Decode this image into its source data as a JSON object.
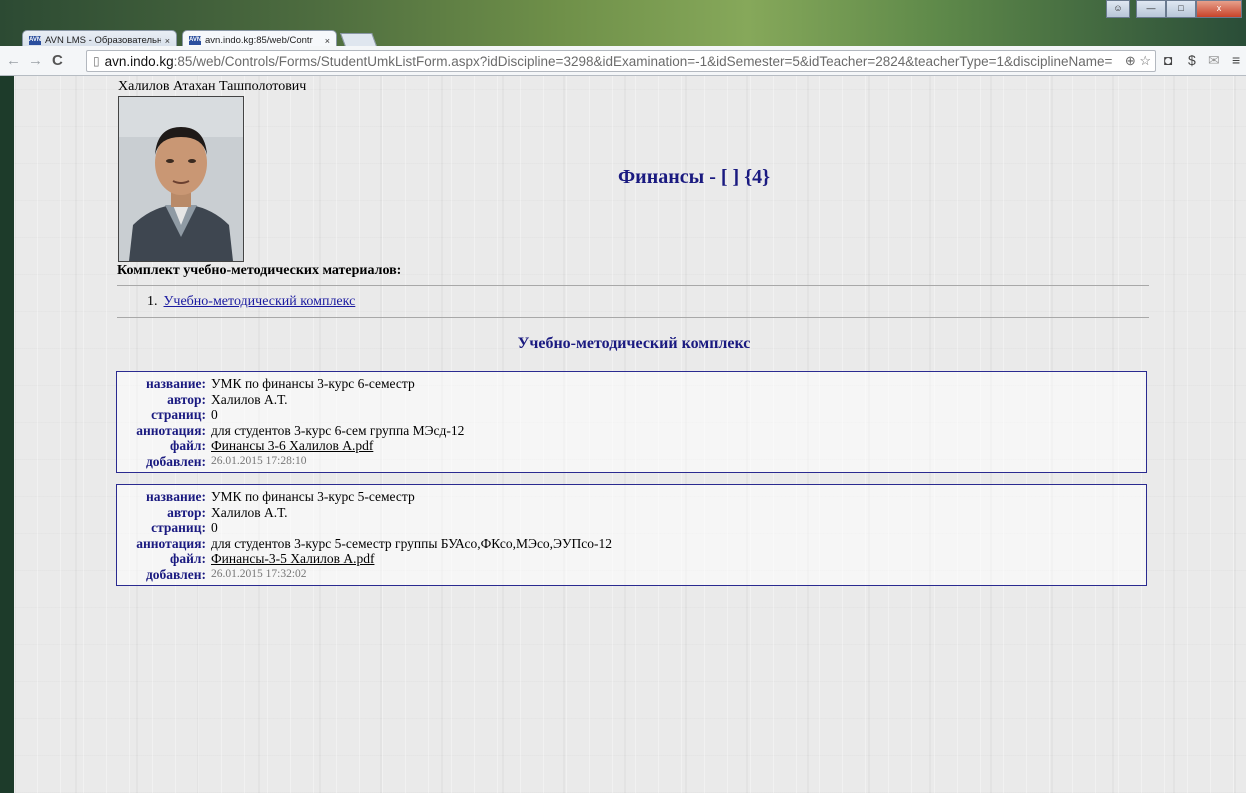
{
  "browser": {
    "tabs": [
      {
        "favicon": "AVN",
        "title": "AVN LMS - Образовательн",
        "close": "×",
        "active": false
      },
      {
        "favicon": "AVN",
        "title": "avn.indo.kg:85/web/Contr",
        "close": "×",
        "active": true
      }
    ],
    "window_controls": {
      "user": "☺",
      "minimize": "—",
      "maximize": "□",
      "close": "x"
    },
    "nav": {
      "back": "←",
      "forward": "→",
      "reload": "C"
    },
    "address": {
      "host": "avn.indo.kg",
      "rest": ":85/web/Controls/Forms/StudentUmkListForm.aspx?idDiscipline=3298&idExamination=-1&idSemester=5&idTeacher=2824&teacherType=1&disciplineName="
    },
    "icons": [
      "zoom-icon",
      "star-icon",
      "pocket-icon",
      "extension-icon",
      "mail-icon",
      "menu-icon"
    ]
  },
  "teacher": {
    "name": "Халилов Атахан Ташполотович"
  },
  "course_title": "Финансы - [ ] {4}",
  "umk_heading": "Комплект учебно-методических материалов:",
  "umk_list": [
    {
      "num": "1.",
      "label": "Учебно-методический комплекс"
    }
  ],
  "section_title": "Учебно-методический комплекс",
  "labels": {
    "name": "название:",
    "author": "автор:",
    "pages": "страниц:",
    "annotation": "аннотация:",
    "file": "файл:",
    "added": "добавлен:"
  },
  "materials": [
    {
      "name": "УМК по финансы 3-курс 6-семестр",
      "author": "Халилов А.Т.",
      "pages": "0",
      "annotation": "для студентов 3-курс 6-сем группа МЭсд-12",
      "file": "Финансы 3-6 Халилов А.pdf",
      "added": "26.01.2015 17:28:10"
    },
    {
      "name": "УМК по финансы 3-курс 5-семестр",
      "author": "Халилов А.Т.",
      "pages": "0",
      "annotation": "для студентов 3-курс 5-семестр группы БУАсо,ФКсо,МЭсо,ЭУПсо-12",
      "file": "Финансы-3-5 Халилов А.pdf",
      "added": "26.01.2015 17:32:02"
    }
  ]
}
